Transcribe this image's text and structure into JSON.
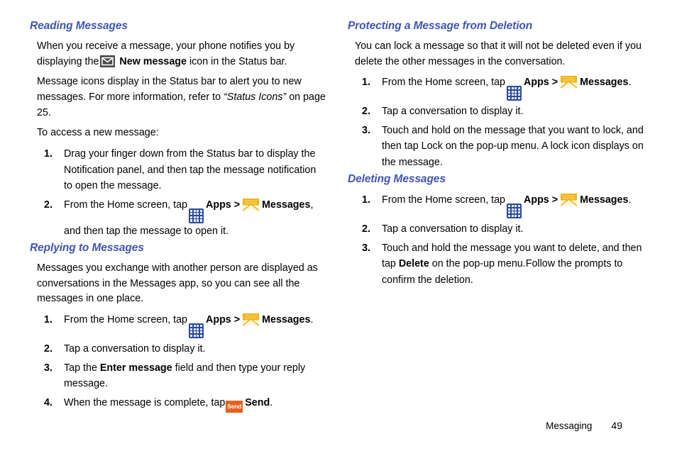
{
  "document": {
    "title": "Messaging",
    "heading_color": "#4055b5",
    "footer": {
      "chapter": "Messaging",
      "page_number": "49"
    }
  },
  "icons": {
    "new_message": {
      "name": "new-message-icon",
      "label": "New message",
      "bg": "#4a4a4a",
      "fg": "#ffffff"
    },
    "apps": {
      "name": "apps-grid-icon",
      "label": "Apps",
      "bg": "#2b4a9b",
      "fg": "#e9ecf5"
    },
    "messages": {
      "name": "messages-envelope-icon",
      "label": "Messages",
      "flap": "#f0b310",
      "body": "#fdf6e6"
    },
    "send": {
      "name": "send-icon",
      "label": "Send",
      "bg": "#e8601c",
      "fg": "#ffffff"
    }
  },
  "left_column": {
    "reading": {
      "heading": "Reading Messages",
      "para1_a": "When you receive a message, your phone notifies you by displaying the",
      "para1_icon_label": "New message",
      "para1_b": "icon in the Status bar.",
      "para2_a": "Message icons display in the Status bar to alert you to new messages. For more information, refer to",
      "para2_ref": "“Status Icons”",
      "para2_b": "on page 25.",
      "para3": "To access a new message:",
      "steps": [
        {
          "num": "1.",
          "text": "Drag your finger down from the Status bar to display the Notification panel, and then tap the message notification to open the message."
        },
        {
          "num": "2.",
          "text_a": "From the Home screen, tap",
          "apps_label": "Apps >",
          "messages_label": "Messages",
          "text_b": ", and then tap the message to open it."
        }
      ]
    },
    "replying": {
      "heading": "Replying to Messages",
      "para1": "Messages you exchange with another person are displayed as conversations in the Messages app, so you can see all the messages in one place.",
      "steps": [
        {
          "num": "1.",
          "text_a": "From the Home screen, tap",
          "apps_label": "Apps >",
          "messages_label": "Messages",
          "text_b": "."
        },
        {
          "num": "2.",
          "text": "Tap a conversation to display it."
        },
        {
          "num": "3.",
          "text_a": "Tap the",
          "bold": "Enter message",
          "text_b": "field and then type your reply message."
        },
        {
          "num": "4.",
          "text_a": "When the message is complete, tap",
          "send_label": "Send",
          "text_b": "."
        }
      ]
    }
  },
  "right_column": {
    "protecting": {
      "heading": "Protecting a Message from Deletion",
      "para1": "You can lock a message so that it will not be deleted even if you delete the other messages in the conversation.",
      "steps": [
        {
          "num": "1.",
          "text_a": "From the Home screen, tap",
          "apps_label": "Apps >",
          "messages_label": "Messages",
          "text_b": "."
        },
        {
          "num": "2.",
          "text": "Tap a conversation to display it."
        },
        {
          "num": "3.",
          "text": "Touch and hold on the message that you want to lock, and then tap Lock on the pop-up menu. A lock icon displays on the message."
        }
      ]
    },
    "deleting": {
      "heading": "Deleting Messages",
      "steps": [
        {
          "num": "1.",
          "text_a": "From the Home screen, tap",
          "apps_label": "Apps >",
          "messages_label": "Messages",
          "text_b": "."
        },
        {
          "num": "2.",
          "text": "Tap a conversation to display it."
        },
        {
          "num": "3.",
          "text_a": "Touch and hold the message you want to delete, and then tap",
          "bold": "Delete",
          "text_b": "on the pop-up menu.Follow the prompts to confirm the deletion."
        }
      ]
    }
  }
}
